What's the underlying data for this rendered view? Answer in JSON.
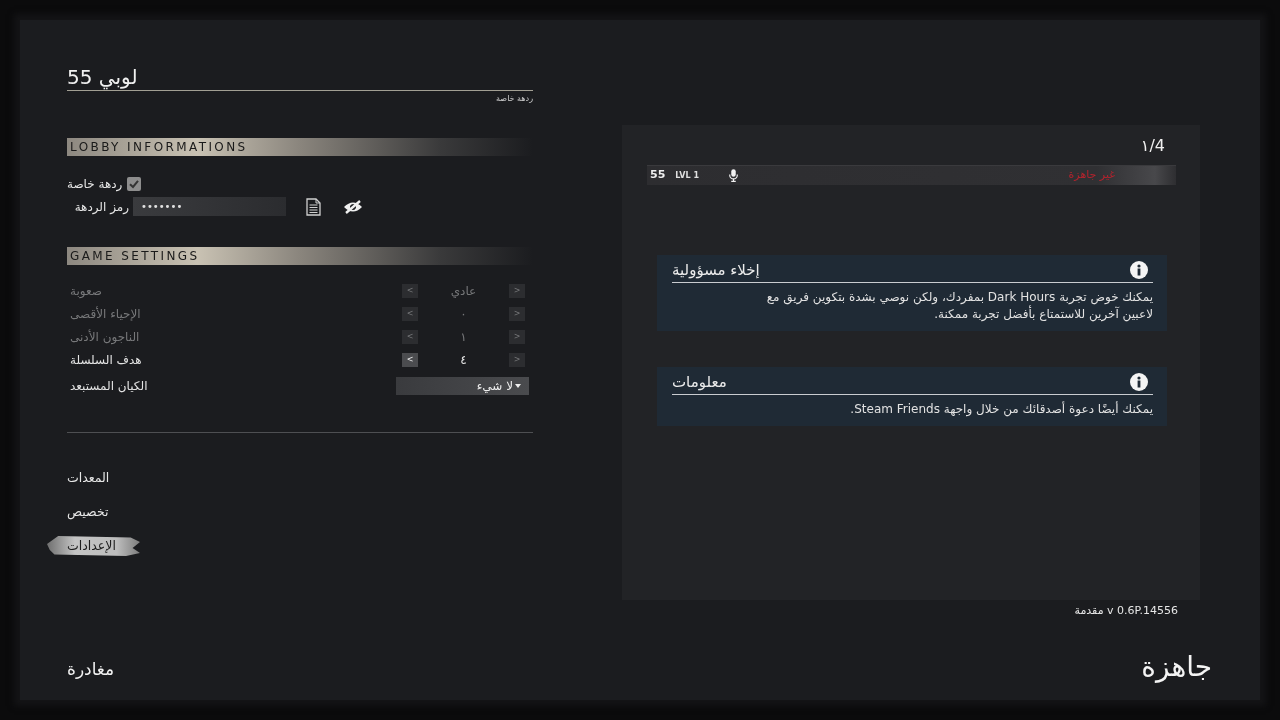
{
  "lobby": {
    "title": "لوبي 55",
    "subtitle": "ردهة خاصة"
  },
  "lobby_informations": {
    "heading": "LOBBY INFORMATIONS",
    "private_lobby": {
      "label": "ردهة خاصة",
      "checked": true
    },
    "lobby_code": {
      "label": "رمز الردهة",
      "value": "•••••••"
    }
  },
  "game_settings": {
    "heading": "GAME SETTINGS",
    "rows": [
      {
        "kind": "stepper",
        "label": "صعوبة",
        "value": "عادي",
        "disabled": true,
        "arrows": [
          {
            "glyph": ">",
            "disabled": true
          },
          {
            "glyph": "<",
            "disabled": true
          }
        ]
      },
      {
        "kind": "stepper",
        "label": "الإحياء الأقصى",
        "value": "٠",
        "disabled": true,
        "arrows": [
          {
            "glyph": ">",
            "disabled": true
          },
          {
            "glyph": "<",
            "disabled": true
          }
        ]
      },
      {
        "kind": "stepper",
        "label": "الناجون الأدنى",
        "value": "١",
        "disabled": true,
        "arrows": [
          {
            "glyph": ">",
            "disabled": true
          },
          {
            "glyph": "<",
            "disabled": true
          }
        ]
      },
      {
        "kind": "stepper",
        "label": "هدف السلسلة",
        "value": "٤",
        "disabled": false,
        "arrows": [
          {
            "glyph": ">",
            "disabled": true
          },
          {
            "glyph": "<",
            "disabled": false
          }
        ]
      },
      {
        "kind": "dropdown",
        "label": "الكيان المستبعد",
        "value": "لا شيء",
        "disabled": false
      }
    ]
  },
  "menu": {
    "items": [
      {
        "label": "المعدات",
        "selected": false
      },
      {
        "label": "تخصيص",
        "selected": false
      },
      {
        "label": "الإعدادات",
        "selected": true
      }
    ]
  },
  "leave_button": "مغادرة",
  "players": {
    "count": "١/4",
    "rows": [
      {
        "name": "55",
        "level": "LVL 1",
        "status": "غير جاهزة",
        "ready": false
      }
    ]
  },
  "notices": [
    {
      "title": "إخلاء مسؤولية",
      "body": "يمكنك خوض تجربة Dark Hours بمفردك، ولكن نوصي بشدة بتكوين فريق مع لاعبين آخرين للاستمتاع بأفضل تجربة ممكنة."
    },
    {
      "title": "معلومات",
      "body": "يمكنك أيضًا دعوة أصدقائك من خلال واجهة Steam Friends."
    }
  ],
  "version": "v 0.6P.14556 مقدمة",
  "ready_button": "جاهزة"
}
